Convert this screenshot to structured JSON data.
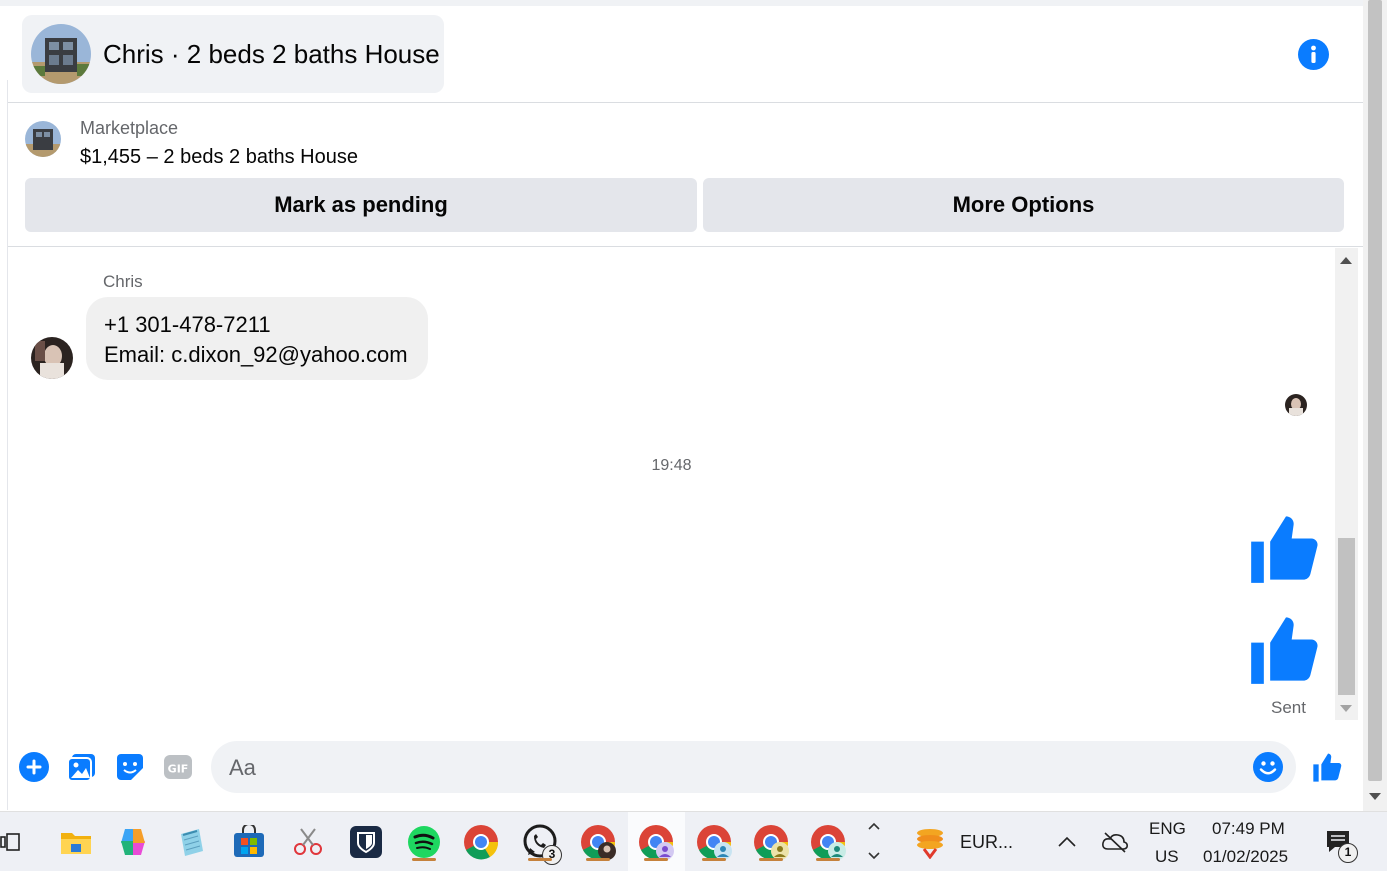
{
  "header": {
    "title": "Chris · 2 beds 2 baths House",
    "info_icon": "info-icon"
  },
  "marketplace": {
    "label": "Marketplace",
    "listing": "$1,455 – 2 beds 2 baths House",
    "mark_pending_label": "Mark as pending",
    "more_options_label": "More Options"
  },
  "messages": {
    "sender_name": "Chris",
    "bubble_lines": [
      "+1 301-478-7211",
      "Email: c.dixon_92@yahoo.com"
    ],
    "timestamp": "19:48",
    "sent_items": [
      "like-icon",
      "like-icon"
    ],
    "status": "Sent"
  },
  "composer": {
    "placeholder": "Aa",
    "icons": [
      "plus-icon",
      "photo-icon",
      "sticker-icon",
      "gif-icon",
      "emoji-icon",
      "like-icon"
    ],
    "gif_label": "GIF"
  },
  "colors": {
    "accent": "#0a7cff",
    "bubble_bg": "#f0f0f0",
    "button_bg": "#e4e6eb"
  },
  "taskbar": {
    "apps": [
      "task-view-icon",
      "file-explorer-icon",
      "copilot-icon",
      "notepad-icon",
      "microsoft-store-icon",
      "snipping-tool-icon",
      "bitwarden-icon",
      "spotify-icon",
      "chrome-icon",
      "whatsapp-icon",
      "chrome-profile-1-icon",
      "chrome-profile-2-icon",
      "chrome-profile-3-icon",
      "chrome-profile-4-icon",
      "chrome-profile-5-icon"
    ],
    "whatsapp_badge": "3",
    "currency_widget": "EUR...",
    "lang_line1": "ENG",
    "lang_line2": "US",
    "time": "07:49 PM",
    "date": "01/02/2025",
    "notifications_badge": "1"
  }
}
